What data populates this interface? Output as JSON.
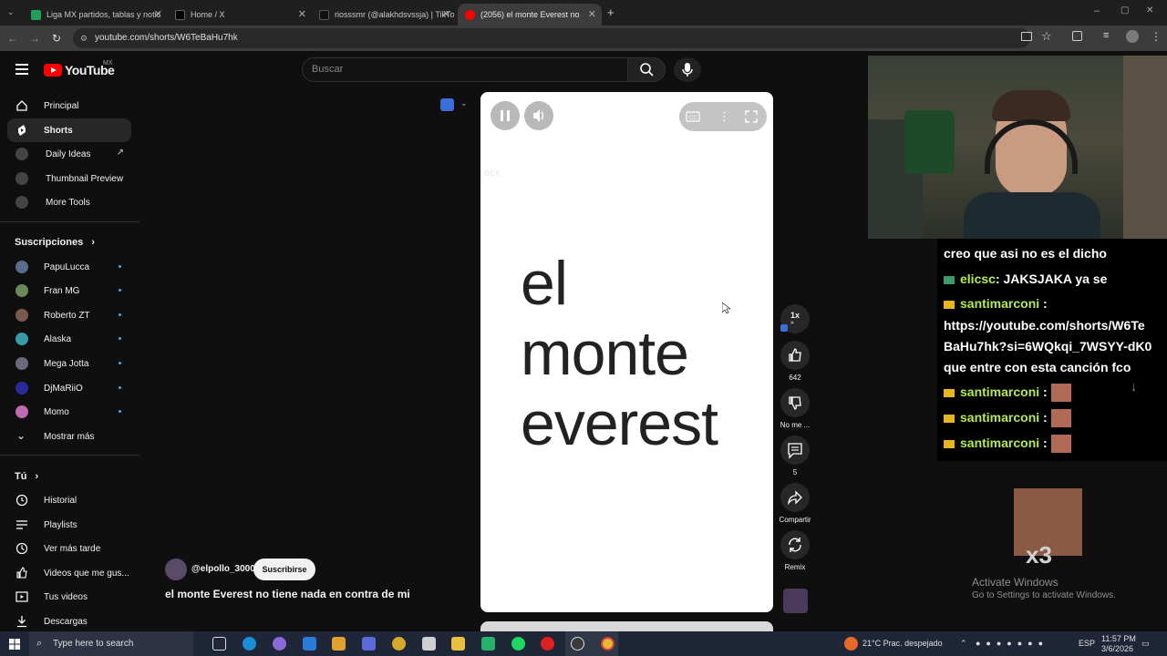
{
  "browser": {
    "tabs": [
      {
        "title": "Liga MX partidos, tablas y notic",
        "color": "#1e9f5a"
      },
      {
        "title": "Home / X",
        "color": "#ffffff"
      },
      {
        "title": "riosssmr (@alakhdsvssja) | TikTo",
        "color": "#ffffff"
      },
      {
        "title": "(2056) el monte Everest no",
        "color": "#ff0000"
      }
    ],
    "url": "youtube.com/shorts/W6TeBaHu7hk"
  },
  "header": {
    "logo": "YouTube",
    "country": "MX",
    "search_placeholder": "Buscar"
  },
  "sidebar": {
    "main": [
      {
        "label": "Principal",
        "icon": "home-icon"
      },
      {
        "label": "Shorts",
        "icon": "shorts-icon",
        "active": true
      },
      {
        "label": "Daily Ideas",
        "icon": "extension-icon"
      },
      {
        "label": "Thumbnail Preview",
        "icon": "extension-icon"
      },
      {
        "label": "More Tools",
        "icon": "extension-icon"
      }
    ],
    "subs_heading": "Suscripciones",
    "subs": [
      {
        "label": "PapuLucca",
        "color": "#5b6b8a"
      },
      {
        "label": "Fran MG",
        "color": "#6a8a5a"
      },
      {
        "label": "Roberto ZT",
        "color": "#7a5a4a"
      },
      {
        "label": "Alaska",
        "color": "#3a9aa8"
      },
      {
        "label": "Mega Jotta",
        "color": "#6a6a7a"
      },
      {
        "label": "DjMaRiiO",
        "color": "#2a2a9a"
      },
      {
        "label": "Momo",
        "color": "#c06ab0"
      }
    ],
    "show_more": "Mostrar más",
    "you_heading": "Tú",
    "you": [
      {
        "label": "Historial",
        "icon": "history-icon"
      },
      {
        "label": "Playlists",
        "icon": "playlists-icon"
      },
      {
        "label": "Ver más tarde",
        "icon": "clock-icon"
      },
      {
        "label": "Videos que me gus...",
        "icon": "like-icon"
      },
      {
        "label": "Tus videos",
        "icon": "video-icon"
      },
      {
        "label": "Descargas",
        "icon": "download-icon"
      }
    ]
  },
  "short": {
    "text_lines": [
      "el",
      "monte",
      "everest"
    ],
    "watermark": "BEK",
    "channel": "@elpollo_3000",
    "subscribe": "Suscribirse",
    "title": "el monte Everest no tiene nada en contra de mi"
  },
  "actions": {
    "speed": "1x",
    "likes": "642",
    "dislike": "No me ...",
    "comments": "5",
    "share": "Compartir",
    "remix": "Remix"
  },
  "chat": [
    {
      "user": "",
      "text": "creo que asi no es el dicho"
    },
    {
      "user": "elicsc",
      "text": ": JAKSJAKA ya se"
    },
    {
      "user": "santimarconi",
      "text": " :"
    },
    {
      "user": "",
      "text": "https://youtube.com/shorts/W6Te"
    },
    {
      "user": "",
      "text": "BaHu7hk?si=6WQkqi_7WSYY-dK0"
    },
    {
      "user": "",
      "text": "que entre con esta canción fco"
    },
    {
      "user": "santimarconi",
      "text": " :"
    },
    {
      "user": "santimarconi",
      "text": " :"
    },
    {
      "user": "santimarconi",
      "text": " :"
    }
  ],
  "overlay": {
    "multiplier": "x3",
    "activate_title": "Activate Windows",
    "activate_sub": "Go to Settings to activate Windows."
  },
  "taskbar": {
    "search": "Type here to search",
    "weather": "21°C  Prac. despejado",
    "lang": "ESP",
    "time": "11:57 PM",
    "date": "3/6/2026"
  }
}
